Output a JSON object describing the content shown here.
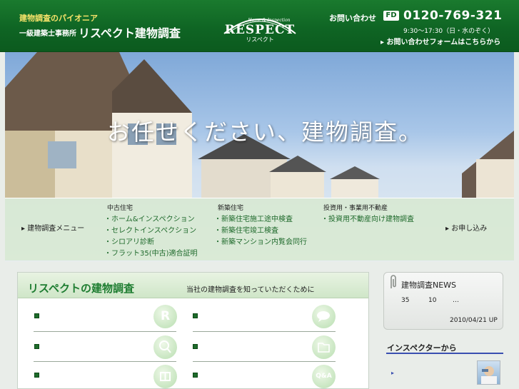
{
  "header": {
    "tagline": "建物調査のパイオニア",
    "company_sub": "一級建築士事務所",
    "company_name": "リスペクト建物調査",
    "logo": {
      "top": "Home & Inspection",
      "main": "RESPECT",
      "kana": "リスペクト"
    },
    "contact_label": "お問い合わせ",
    "fd_badge": "FD",
    "phone": "0120-769-321",
    "hours": "9:30～17:30（日・水のぞく）",
    "form_link": "▸ お問い合わせフォームはこちらから"
  },
  "hero": {
    "copy": "お任せください、建物調査。"
  },
  "menu": {
    "label": "▸ 建物調査メニュー",
    "columns": [
      {
        "heading": "中古住宅",
        "items": [
          "・ホーム&インスペクション",
          "・セレクトインスペクション",
          "・シロアリ診断",
          "・フラット35(中古)適合証明"
        ]
      },
      {
        "heading": "新築住宅",
        "items": [
          "・新築住宅施工途中検査",
          "・新築住宅竣工検査",
          "・新築マンション内覧会同行"
        ]
      },
      {
        "heading": "投資用・事業用不動産",
        "items": [
          "・投資用不動産向け建物調査"
        ]
      }
    ],
    "apply": "▸ お申し込み"
  },
  "main": {
    "title": "リスペクトの建物調査",
    "subtitle": "当社の建物調査を知っていただくために",
    "icons": [
      "R",
      "",
      "",
      "",
      "",
      "Q&A"
    ]
  },
  "news": {
    "title": "建物調査NEWS",
    "n1": "35",
    "n2": "10",
    "n3": "…",
    "date": "2010/04/21 UP"
  },
  "inspector": {
    "title": "インスペクターから",
    "bullet": "▸"
  }
}
